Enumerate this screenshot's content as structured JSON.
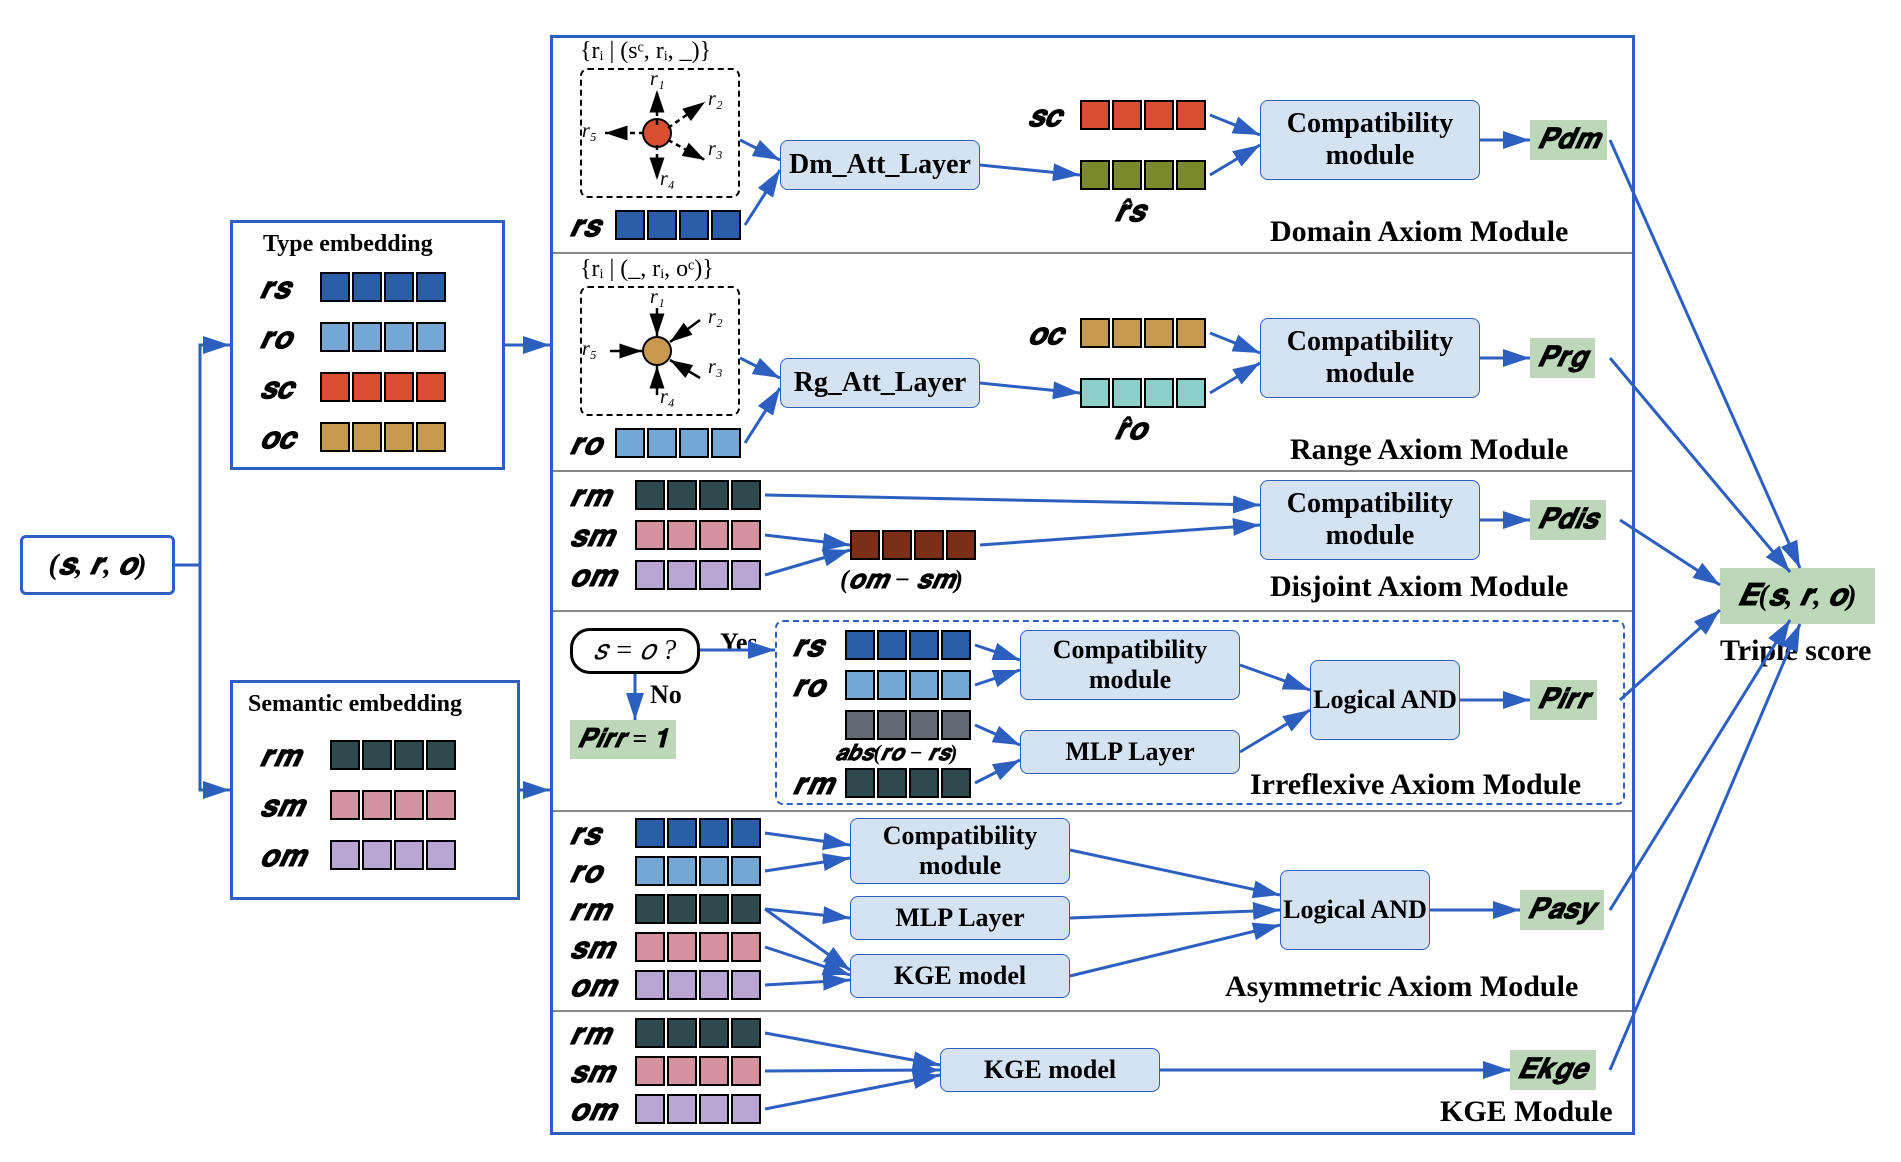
{
  "input_triple": "(𝒔, 𝒓, 𝒐)",
  "type_embedding": {
    "title": "Type embedding",
    "rows": [
      {
        "label": "𝒓𝒔",
        "color": "c-rs"
      },
      {
        "label": "𝒓𝒐",
        "color": "c-ro"
      },
      {
        "label": "𝒔𝒄",
        "color": "c-sc"
      },
      {
        "label": "𝒐𝒄",
        "color": "c-oc"
      }
    ]
  },
  "semantic_embedding": {
    "title": "Semantic embedding",
    "rows": [
      {
        "label": "𝒓𝒎",
        "color": "c-rm"
      },
      {
        "label": "𝒔𝒎",
        "color": "c-sm"
      },
      {
        "label": "𝒐𝒎",
        "color": "c-om"
      }
    ]
  },
  "modules": {
    "domain": {
      "set_label": "{rᵢ | (sᶜ, rᵢ, _)}",
      "r_labels": [
        "r₁",
        "r₂",
        "r₃",
        "r₄",
        "r₅"
      ],
      "att_layer": "Dm_Att_Layer",
      "sc_label": "𝒔𝒄",
      "rhat_label": "𝒓̂𝒔",
      "compat": "Compatibility module",
      "p_label": "𝑷𝒅𝒎",
      "title": "Domain Axiom Module",
      "rs_label": "𝒓𝒔"
    },
    "range": {
      "set_label": "{rᵢ | (_, rᵢ, oᶜ)}",
      "r_labels": [
        "r₁",
        "r₂",
        "r₃",
        "r₄",
        "r₅"
      ],
      "att_layer": "Rg_Att_Layer",
      "oc_label": "𝒐𝒄",
      "rhat_label": "𝒓̂𝒐",
      "compat": "Compatibility module",
      "p_label": "𝑷𝒓𝒈",
      "title": "Range Axiom Module",
      "ro_label": "𝒓𝒐"
    },
    "disjoint": {
      "rm_label": "𝒓𝒎",
      "sm_label": "𝒔𝒎",
      "om_label": "𝒐𝒎",
      "diff_label": "(𝒐𝒎 − 𝒔𝒎)",
      "compat": "Compatibility module",
      "p_label": "𝑷𝒅𝒊𝒔",
      "title": "Disjoint Axiom Module"
    },
    "irreflexive": {
      "question": "𝑠 = 𝑜 ?",
      "yes": "Yes",
      "no": "No",
      "p_one": "𝑷𝒊𝒓𝒓 = 𝟏",
      "rs_label": "𝒓𝒔",
      "ro_label": "𝒓𝒐",
      "abs_label": "𝒂𝒃𝒔(𝒓𝒐 − 𝒓𝒔)",
      "rm_label": "𝒓𝒎",
      "compat": "Compatibility module",
      "mlp": "MLP Layer",
      "and": "Logical AND",
      "p_label": "𝑷𝒊𝒓𝒓",
      "title": "Irreflexive Axiom Module"
    },
    "asymmetric": {
      "rs_label": "𝒓𝒔",
      "ro_label": "𝒓𝒐",
      "rm_label": "𝒓𝒎",
      "sm_label": "𝒔𝒎",
      "om_label": "𝒐𝒎",
      "compat": "Compatibility module",
      "mlp": "MLP Layer",
      "kge": "KGE model",
      "and": "Logical AND",
      "p_label": "𝑷𝒂𝒔𝒚",
      "title": "Asymmetric Axiom Module"
    },
    "kge": {
      "rm_label": "𝒓𝒎",
      "sm_label": "𝒔𝒎",
      "om_label": "𝒐𝒎",
      "kge": "KGE model",
      "e_label": "𝑬𝒌𝒈𝒆",
      "title": "KGE Module"
    }
  },
  "output": {
    "score": "𝑬(𝒔, 𝒓, 𝒐)",
    "label": "Triple score"
  }
}
